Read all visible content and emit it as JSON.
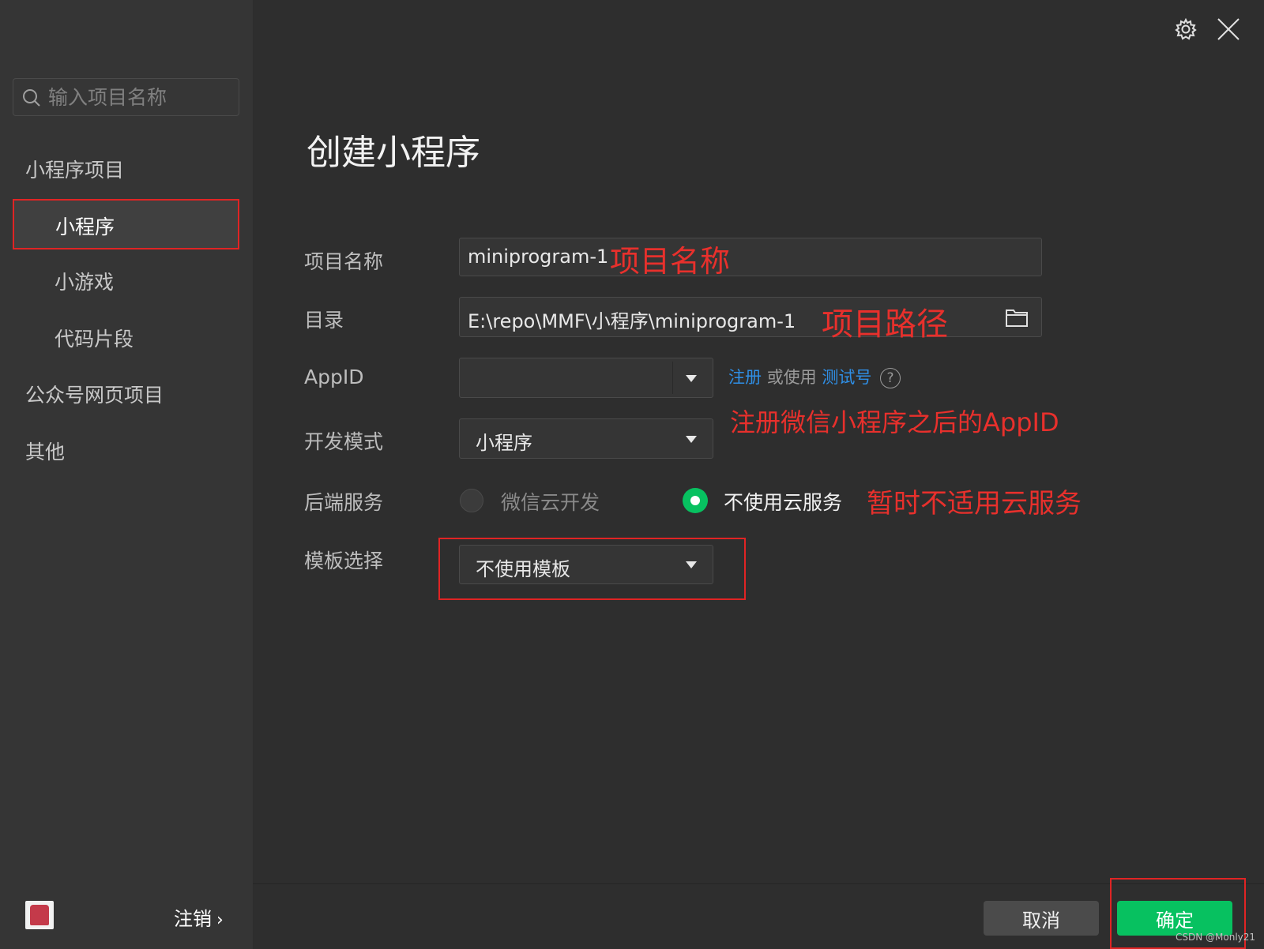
{
  "sidebar": {
    "search_placeholder": "输入项目名称",
    "section_miniprogram": "小程序项目",
    "items": [
      {
        "label": "小程序"
      },
      {
        "label": "小游戏"
      },
      {
        "label": "代码片段"
      }
    ],
    "section_web": "公众号网页项目",
    "section_other": "其他",
    "logout_label": "注销",
    "logout_chevron": "›"
  },
  "header": {
    "title": "创建小程序"
  },
  "form": {
    "project_name": {
      "label": "项目名称",
      "value": "miniprogram-1"
    },
    "directory": {
      "label": "目录",
      "value": "E:\\repo\\MMF\\小程序\\miniprogram-1"
    },
    "appid": {
      "label": "AppID",
      "value": "",
      "register_link": "注册",
      "or_use": "或使用",
      "test_link": "测试号",
      "help": "?"
    },
    "dev_mode": {
      "label": "开发模式",
      "value": "小程序"
    },
    "backend": {
      "label": "后端服务",
      "options": [
        "微信云开发",
        "不使用云服务"
      ],
      "selected": "不使用云服务"
    },
    "template": {
      "label": "模板选择",
      "value": "不使用模板"
    }
  },
  "annotations": {
    "name": "项目名称",
    "path": "项目路径",
    "appid": "注册微信小程序之后的AppID",
    "cloud": "暂时不适用云服务"
  },
  "footer": {
    "cancel_label": "取消",
    "confirm_label": "确定",
    "watermark": "CSDN @Monly21"
  },
  "colors": {
    "accent_green": "#07c160",
    "link_blue": "#2f8fe6",
    "annotation_red": "#e8302c"
  }
}
